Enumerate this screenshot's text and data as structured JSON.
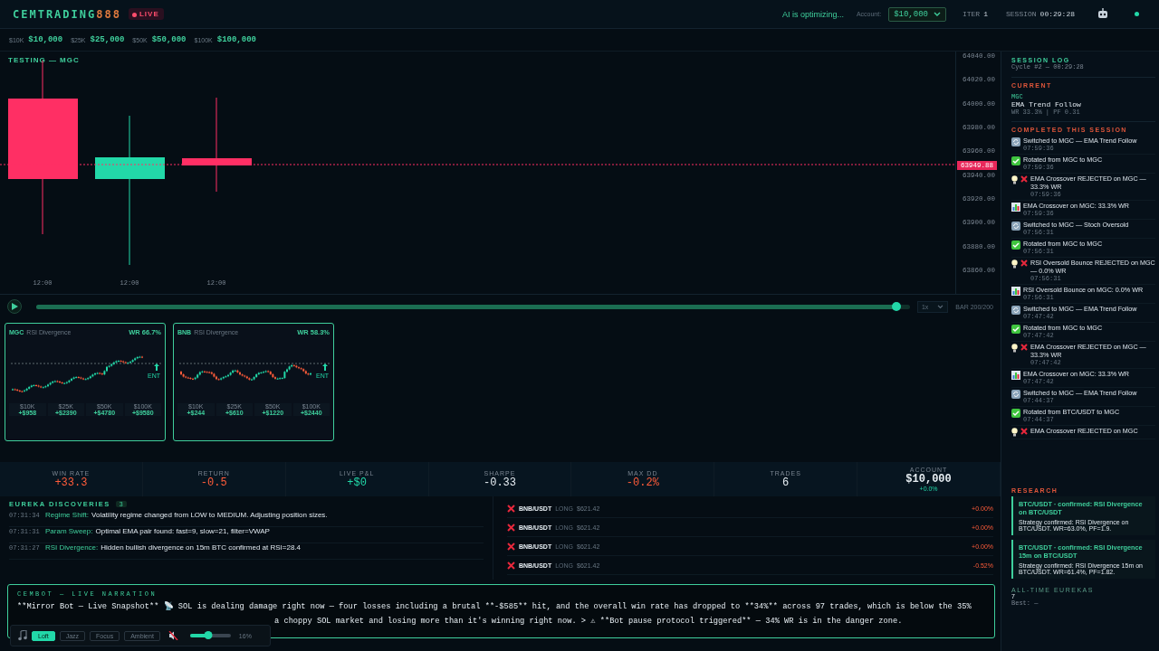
{
  "header": {
    "logo_main": "CEMTRADING",
    "logo_accent": "888",
    "live_badge": "LIVE",
    "status": "AI is optimizing...",
    "account_label": "Account:",
    "account_value": "$10,000",
    "iter_label": "ITER",
    "iter_value": "1",
    "session_label": "SESSION",
    "session_value": "00:29:28",
    "online": true
  },
  "presets": [
    {
      "label": "$10K",
      "value": "$10,000"
    },
    {
      "label": "$25K",
      "value": "$25,000"
    },
    {
      "label": "$50K",
      "value": "$50,000"
    },
    {
      "label": "$100K",
      "value": "$100,000"
    }
  ],
  "chart": {
    "title": "TESTING — MGC",
    "price_ticks": [
      "64040.00",
      "64020.00",
      "64000.00",
      "63980.00",
      "63960.00",
      "63940.00",
      "63920.00",
      "63900.00",
      "63880.00",
      "63860.00"
    ],
    "current_price": "63949.88",
    "time_labels": [
      "12:00",
      "12:00",
      "12:00"
    ]
  },
  "replay": {
    "level": 0.985,
    "speed": "1x",
    "bar_reading": "BAR 200/200"
  },
  "mini_cards": [
    {
      "symbol": "MGC",
      "strategy": "RSI Divergence",
      "win_rate": "WR 66.7%",
      "entry": "ENT",
      "tiers": [
        {
          "label": "$10K",
          "value": "+$958"
        },
        {
          "label": "$25K",
          "value": "+$2390"
        },
        {
          "label": "$50K",
          "value": "+$4780"
        },
        {
          "label": "$100K",
          "value": "+$9580"
        }
      ]
    },
    {
      "symbol": "BNB",
      "strategy": "RSI Divergence",
      "win_rate": "WR 58.3%",
      "entry": "ENT",
      "tiers": [
        {
          "label": "$10K",
          "value": "+$244"
        },
        {
          "label": "$25K",
          "value": "+$610"
        },
        {
          "label": "$50K",
          "value": "+$1220"
        },
        {
          "label": "$100K",
          "value": "+$2440"
        }
      ]
    }
  ],
  "stats": [
    {
      "label": "WIN RATE",
      "value": "+33.3",
      "color": "#ff5c3a"
    },
    {
      "label": "RETURN",
      "value": "-0.5",
      "color": "#ff5c3a"
    },
    {
      "label": "LIVE P&L",
      "value": "+$0",
      "color": "#22d8a8"
    },
    {
      "label": "SHARPE",
      "value": "-0.33",
      "color": "#e6edf2"
    },
    {
      "label": "MAX DD",
      "value": "-0.2%",
      "color": "#ff5c3a"
    },
    {
      "label": "TRADES",
      "value": "6",
      "color": "#e6edf2"
    },
    {
      "label": "ACCOUNT",
      "value": "$10,000",
      "color": "#e6edf2",
      "sub": "+0.0%"
    }
  ],
  "eureka": {
    "title": "EUREKA DISCOVERIES",
    "count": "3",
    "items": [
      {
        "time": "07:31:34",
        "tag": "Regime Shift:",
        "text": "Volatility regime changed from LOW to MEDIUM. Adjusting position sizes."
      },
      {
        "time": "07:31:31",
        "tag": "Param Sweep:",
        "text": "Optimal EMA pair found: fast=9, slow=21, filter=VWAP"
      },
      {
        "time": "07:31:27",
        "tag": "RSI Divergence:",
        "text": "Hidden bullish divergence on 15m BTC confirmed at RSI=28.4"
      }
    ]
  },
  "trades": [
    {
      "symbol": "BNB/USDT",
      "side": "LONG",
      "price": "$621.42",
      "change": "+0.00%"
    },
    {
      "symbol": "BNB/USDT",
      "side": "LONG",
      "price": "$621.42",
      "change": "+0.00%"
    },
    {
      "symbol": "BNB/USDT",
      "side": "LONG",
      "price": "$621.42",
      "change": "+0.00%"
    },
    {
      "symbol": "BNB/USDT",
      "side": "LONG",
      "price": "$621.42",
      "change": "-0.52%"
    }
  ],
  "narration": {
    "title": "CEMBOT — LIVE NARRATION",
    "line_1": "**Mirror Bot — Live Snapshot** 📡 SOL is dealing damage right now — four losses including a brutal **-$585** hit, and the overall win rate has dropped to **34%** across 97 trades, which is below the 35%",
    "line_2": "a choppy SOL market and losing more than it's winning right now. > ⚠ **Bot pause protocol triggered** — 34% WR is in the danger zone."
  },
  "music": {
    "stations": [
      {
        "label": "Loft",
        "selected": true
      },
      {
        "label": "Jazz",
        "selected": false
      },
      {
        "label": "Focus",
        "selected": false
      },
      {
        "label": "Ambient",
        "selected": false
      }
    ],
    "muted": true,
    "level": 0.45,
    "reading": "16%"
  },
  "session_log": {
    "title": "SESSION LOG",
    "cycle": "Cycle #2 — 00:29:28",
    "current_label": "CURRENT",
    "current_symbol": "MGC",
    "current_strategy": "EMA Trend Follow",
    "current_stats": "WR 33.3% | PF 0.31",
    "completed_label": "COMPLETED THIS SESSION",
    "items": [
      {
        "kind": "switch",
        "text": "Switched to MGC — EMA Trend Follow",
        "time": "07:59:36"
      },
      {
        "kind": "check",
        "text": "Rotated from MGC to MGC",
        "time": "07:59:36"
      },
      {
        "kind": "reject",
        "text": "EMA Crossover REJECTED on MGC — 33.3% WR",
        "time": "07:59:36"
      },
      {
        "kind": "stat",
        "text": "EMA Crossover on MGC: 33.3% WR",
        "time": "07:59:36"
      },
      {
        "kind": "switch",
        "text": "Switched to MGC — Stoch Oversold",
        "time": "07:56:31"
      },
      {
        "kind": "check",
        "text": "Rotated from MGC to MGC",
        "time": "07:56:31"
      },
      {
        "kind": "reject",
        "text": "RSI Oversold Bounce REJECTED on MGC — 0.0% WR",
        "time": "07:56:31"
      },
      {
        "kind": "stat",
        "text": "RSI Oversold Bounce on MGC: 0.0% WR",
        "time": "07:56:31"
      },
      {
        "kind": "switch",
        "text": "Switched to MGC — EMA Trend Follow",
        "time": "07:47:42"
      },
      {
        "kind": "check",
        "text": "Rotated from MGC to MGC",
        "time": "07:47:42"
      },
      {
        "kind": "reject",
        "text": "EMA Crossover REJECTED on MGC — 33.3% WR",
        "time": "07:47:42"
      },
      {
        "kind": "stat",
        "text": "EMA Crossover on MGC: 33.3% WR",
        "time": "07:47:42"
      },
      {
        "kind": "switch",
        "text": "Switched to MGC — EMA Trend Follow",
        "time": "07:44:37"
      },
      {
        "kind": "check",
        "text": "Rotated from BTC/USDT to MGC",
        "time": "07:44:37"
      },
      {
        "kind": "reject",
        "text": "EMA Crossover REJECTED on MGC"
      }
    ]
  },
  "research": {
    "title": "RESEARCH",
    "items": [
      {
        "title": "BTC/USDT · confirmed: RSI Divergence on BTC/USDT",
        "body": "Strategy confirmed: RSI Divergence on BTC/USDT. WR=63.0%, PF=1.9."
      },
      {
        "title": "BTC/USDT · confirmed: RSI Divergence 15m on BTC/USDT",
        "body": "Strategy confirmed: RSI Divergence 15m on BTC/USDT. WR=61.4%, PF=1.82."
      }
    ]
  },
  "eurekas_total": {
    "title": "ALL-TIME EUREKAS",
    "count": "7",
    "best": "Best: —"
  }
}
